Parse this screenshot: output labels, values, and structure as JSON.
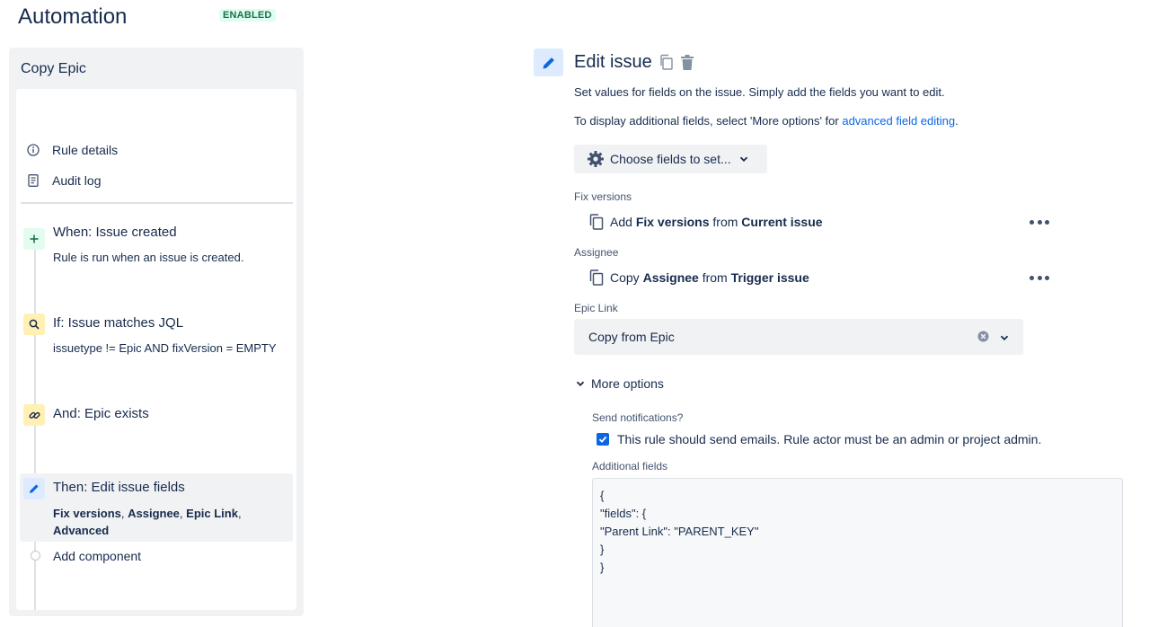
{
  "header": {
    "title": "Automation",
    "status": "ENABLED"
  },
  "rule": {
    "name": "Copy Epic",
    "menu": [
      {
        "label": "Rule details",
        "icon": "info-icon"
      },
      {
        "label": "Audit log",
        "icon": "document-icon"
      }
    ],
    "components": [
      {
        "title": "When: Issue created",
        "description": "Rule is run when an issue is created.",
        "icon": "plus-icon",
        "color": "#e3fcef"
      },
      {
        "title": "If: Issue matches JQL",
        "description": "issuetype != Epic AND fixVersion = EMPTY",
        "icon": "search-icon",
        "color": "#fff0b3"
      },
      {
        "title": "And: Epic exists",
        "icon": "link-icon",
        "color": "#fff0b3"
      },
      {
        "title": "Then: Edit issue fields",
        "detail_parts": [
          "Fix versions",
          ", ",
          "Assignee",
          ", ",
          "Epic Link",
          ",",
          "Advanced"
        ],
        "icon": "pencil-icon",
        "color": "#deebff"
      }
    ],
    "add_component": "Add component"
  },
  "action": {
    "title": "Edit issue",
    "description": "Set values for fields on the issue. Simply add the fields you want to edit.",
    "more_info_prefix": "To display additional fields, select 'More options' for ",
    "more_info_link": "advanced field editing",
    "more_info_suffix": ".",
    "choose_button": "Choose fields to set...",
    "fields": [
      {
        "label": "Fix versions",
        "parts": [
          "Add ",
          "Fix versions",
          " from ",
          "Current issue"
        ]
      },
      {
        "label": "Assignee",
        "parts": [
          "Copy ",
          "Assignee",
          " from ",
          "Trigger issue"
        ]
      }
    ],
    "epic_link": {
      "label": "Epic Link",
      "value": "Copy from Epic"
    },
    "more_options": {
      "label": "More options",
      "send_notifications_label": "Send notifications?",
      "send_notifications_text": "This rule should send emails. Rule actor must be an admin or project admin.",
      "send_notifications_checked": true,
      "additional_fields_label": "Additional fields",
      "additional_fields_value": "{\n\"fields\": {\n\"Parent Link\": \"PARENT_KEY\"\n}\n}"
    }
  },
  "colors": {
    "accent": "#0c66e4",
    "enabled_badge_bg": "#dcfff1",
    "enabled_badge_text": "#216e4e"
  }
}
